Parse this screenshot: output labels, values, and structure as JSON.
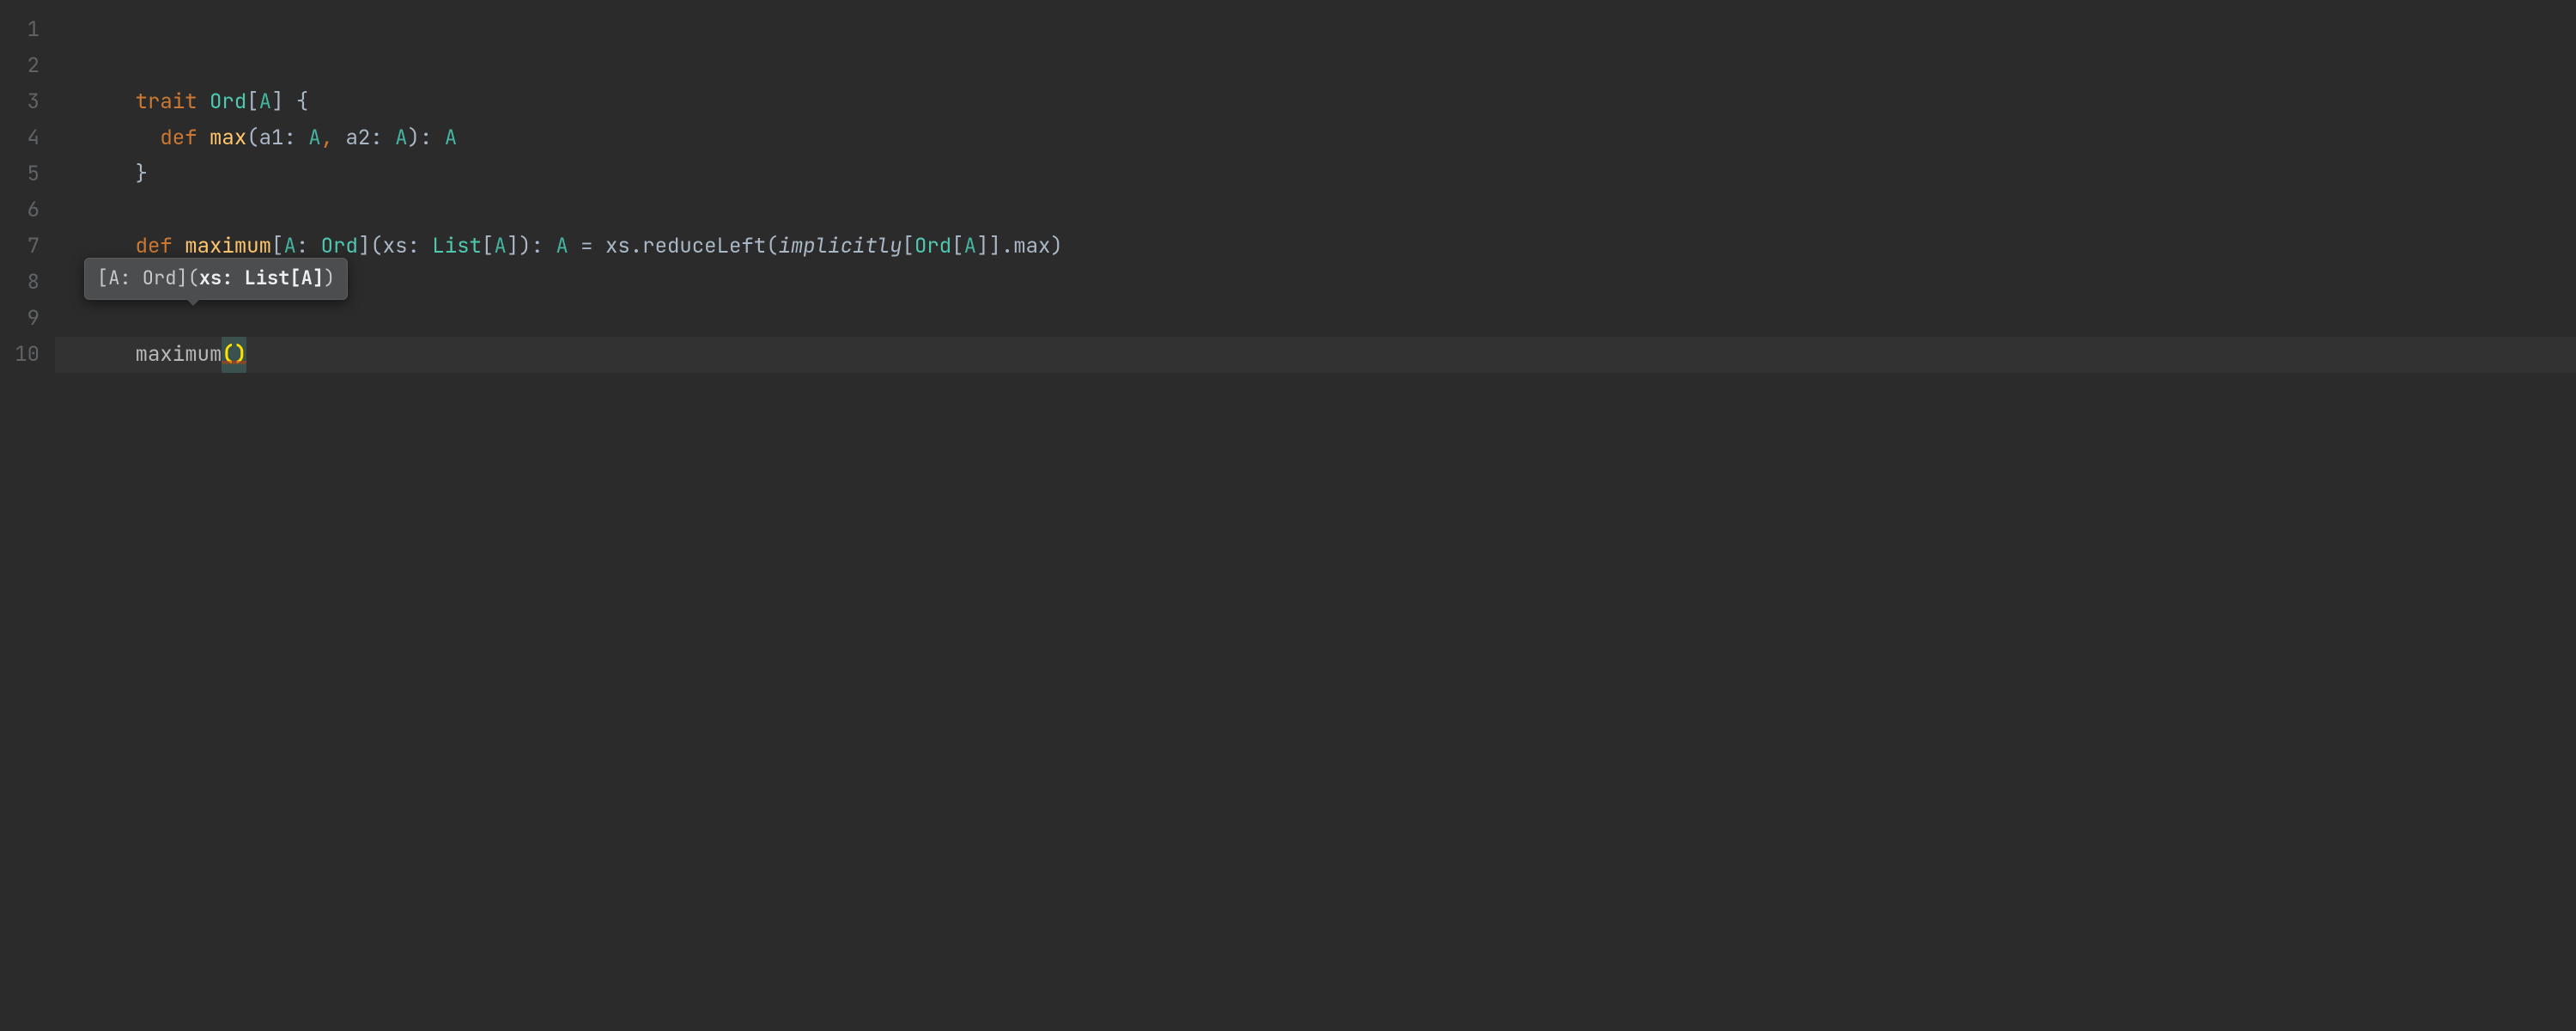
{
  "colors": {
    "background": "#2b2b2b",
    "gutter": "#606366",
    "currentLine": "#323232",
    "keyword": "#cc7832",
    "type": "#4ec9b0",
    "method": "#ffc66d",
    "text": "#a9b7c6",
    "tooltipBg": "#4b4d4f",
    "caretParen": "#ffe100"
  },
  "gutter": {
    "lines": [
      "1",
      "2",
      "3",
      "4",
      "5",
      "6",
      "7",
      "8",
      "9",
      "10"
    ]
  },
  "code": {
    "line3": {
      "indent": "    ",
      "kw_trait": "trait",
      "type_Ord": "Ord",
      "lbr": "[",
      "A": "A",
      "rbr": "]",
      "sp": " ",
      "obrace": "{"
    },
    "line4": {
      "indent": "      ",
      "kw_def": "def",
      "method": "max",
      "op": "(",
      "a1": "a1",
      "colon1": ": ",
      "A1": "A",
      "comma": ",",
      "sp": " ",
      "a2": "a2",
      "colon2": ": ",
      "A2": "A",
      "cp": ")",
      "retcolon": ": ",
      "Aret": "A"
    },
    "line5": {
      "indent": "    ",
      "cbrace": "}"
    },
    "line7": {
      "indent": "    ",
      "kw_def": "def",
      "sp1": " ",
      "method": "maximum",
      "lbr": "[",
      "A": "A",
      "colonOrd": ": ",
      "Ord": "Ord",
      "rbr": "]",
      "op": "(",
      "xs": "xs",
      "colonList": ": ",
      "List": "List",
      "lbr2": "[",
      "A2": "A",
      "rbr2": "]",
      "cp": ")",
      "retcolon": ": ",
      "Aret": "A",
      "eq": " = ",
      "xs2": "xs",
      "dot1": ".",
      "reduceLeft": "reduceLeft",
      "op2": "(",
      "implicitly": "implicitly",
      "lbr3": "[",
      "Ord2": "Ord",
      "lbr4": "[",
      "A3": "A",
      "rbr4": "]",
      "rbr3": "]",
      "dot2": ".",
      "max": "max",
      "cp2": ")"
    },
    "line10": {
      "indent": "    ",
      "call": "maximum",
      "op": "(",
      "cp": ")"
    }
  },
  "tooltip": {
    "prefix": "[A: Ord](",
    "bold": "xs: List[A]",
    "suffix": ")"
  }
}
